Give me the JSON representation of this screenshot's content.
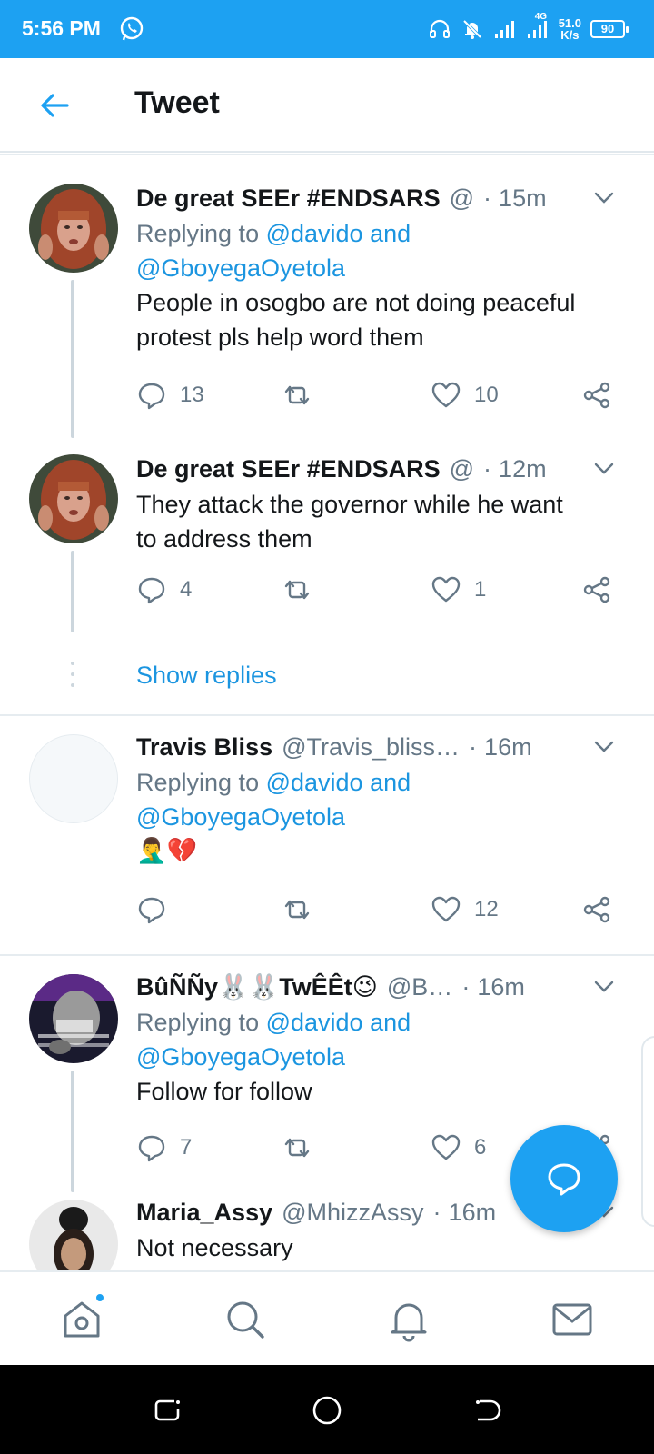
{
  "status_bar": {
    "time": "5:56 PM",
    "network_type": "4G",
    "net_speed_value": "51.0",
    "net_speed_unit": "K/s",
    "battery": "90",
    "icons": [
      "whatsapp-icon",
      "headset-icon",
      "mute-icon",
      "signal-icon",
      "signal-4g-icon",
      "battery-icon"
    ]
  },
  "header": {
    "title": "Tweet"
  },
  "tweets": [
    {
      "name": "De great SEEr #ENDSARS",
      "handle": "@",
      "time": "15m",
      "replying_prefix": "Replying to ",
      "replying_line1": "@davido and",
      "replying_line2": "@GboyegaOyetola",
      "text_line1": "People in osogbo are not doing peaceful",
      "text_line2": "protest  pls help word them",
      "replies": "13",
      "retweets": "",
      "likes": "10"
    },
    {
      "name": "De great SEEr #ENDSARS",
      "handle": "@",
      "time": "12m",
      "text_line1": "They attack the governor while he want",
      "text_line2": "to address them",
      "replies": "4",
      "retweets": "",
      "likes": "1"
    },
    {
      "name": "Travis Bliss",
      "handle": "@Travis_bliss…",
      "time": "16m",
      "replying_prefix": "Replying to ",
      "replying_line1": "@davido and",
      "replying_line2": "@GboyegaOyetola",
      "text_line1": "🤦‍♂️💔",
      "replies": "",
      "retweets": "",
      "likes": "12"
    },
    {
      "name": "BûÑÑy🐰🐰TwÊÊt😉",
      "handle": "@B…",
      "time": "16m",
      "replying_prefix": "Replying to ",
      "replying_line1": "@davido and",
      "replying_line2": "@GboyegaOyetola",
      "text_line1": "Follow for follow",
      "replies": "7",
      "retweets": "",
      "likes": "6"
    },
    {
      "name": "Maria_Assy",
      "handle": "@MhizzAssy",
      "time": "16m",
      "text_line1": "Not necessary"
    }
  ],
  "show_replies_label": "Show replies",
  "dot_separator": "·",
  "colors": {
    "brand": "#1da1f2",
    "link": "#1b95e0",
    "muted": "#657786"
  }
}
